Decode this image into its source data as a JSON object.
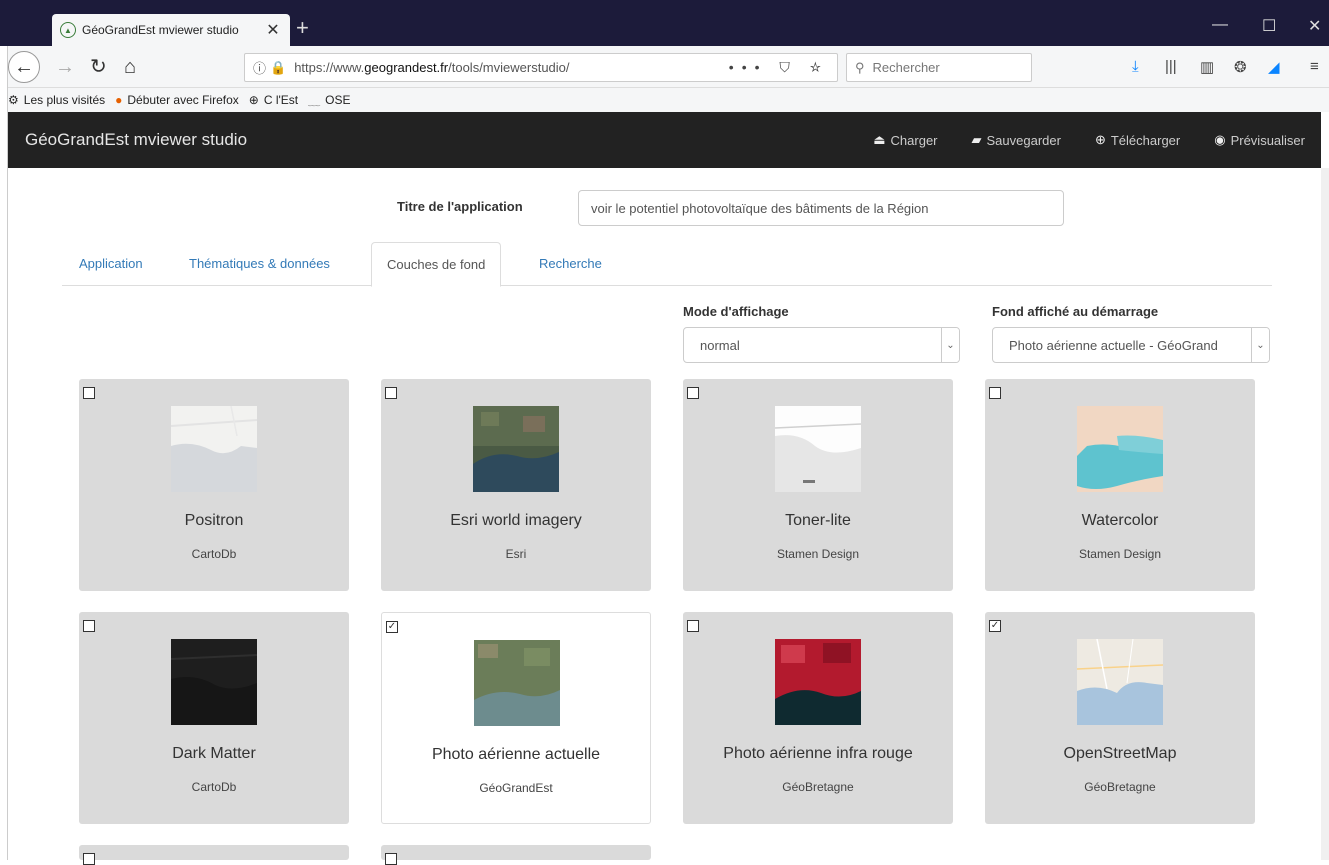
{
  "browser": {
    "tab_title": "GéoGrandEst mviewer studio",
    "url_prefix": "https://www.",
    "url_domain": "geograndest.fr",
    "url_path": "/tools/mviewerstudio/",
    "url_more": "•••",
    "search_placeholder": "Rechercher",
    "bookmarks": [
      {
        "label": "Les plus visités",
        "icon": "gear-icon"
      },
      {
        "label": "Débuter avec Firefox",
        "icon": "firefox-icon"
      },
      {
        "label": "C l'Est",
        "icon": "globe-icon"
      },
      {
        "label": "OSE",
        "icon": "leaf-icon"
      }
    ]
  },
  "app": {
    "brand": "GéoGrandEst mviewer studio",
    "menu": [
      {
        "label": "Charger",
        "icon": "upload-icon"
      },
      {
        "label": "Sauvegarder",
        "icon": "save-icon"
      },
      {
        "label": "Télécharger",
        "icon": "download-icon"
      },
      {
        "label": "Prévisualiser",
        "icon": "globe-icon"
      }
    ]
  },
  "form": {
    "title_label": "Titre de l'application",
    "title_value": "voir le potentiel photovoltaïque des bâtiments de la Région"
  },
  "tabs": [
    {
      "label": "Application",
      "active": false
    },
    {
      "label": "Thématiques & données",
      "active": false
    },
    {
      "label": "Couches de fond",
      "active": true
    },
    {
      "label": "Recherche",
      "active": false
    }
  ],
  "display_mode": {
    "label": "Mode d'affichage",
    "value": "normal"
  },
  "startup_layer": {
    "label": "Fond affiché au démarrage",
    "value": "Photo aérienne actuelle - GéoGrand"
  },
  "layers": [
    {
      "name": "Positron",
      "source": "CartoDb",
      "checked": false,
      "selected": false,
      "thumb": "positron"
    },
    {
      "name": "Esri world imagery",
      "source": "Esri",
      "checked": false,
      "selected": false,
      "thumb": "esri"
    },
    {
      "name": "Toner-lite",
      "source": "Stamen Design",
      "checked": false,
      "selected": false,
      "thumb": "toner"
    },
    {
      "name": "Watercolor",
      "source": "Stamen Design",
      "checked": false,
      "selected": false,
      "thumb": "watercolor"
    },
    {
      "name": "Dark Matter",
      "source": "CartoDb",
      "checked": false,
      "selected": false,
      "thumb": "dark"
    },
    {
      "name": "Photo aérienne actuelle",
      "source": "GéoGrandEst",
      "checked": true,
      "selected": true,
      "thumb": "aerial"
    },
    {
      "name": "Photo aérienne infra rouge",
      "source": "GéoBretagne",
      "checked": false,
      "selected": false,
      "thumb": "infrared"
    },
    {
      "name": "OpenStreetMap",
      "source": "GéoBretagne",
      "checked": true,
      "selected": false,
      "thumb": "osm"
    }
  ]
}
